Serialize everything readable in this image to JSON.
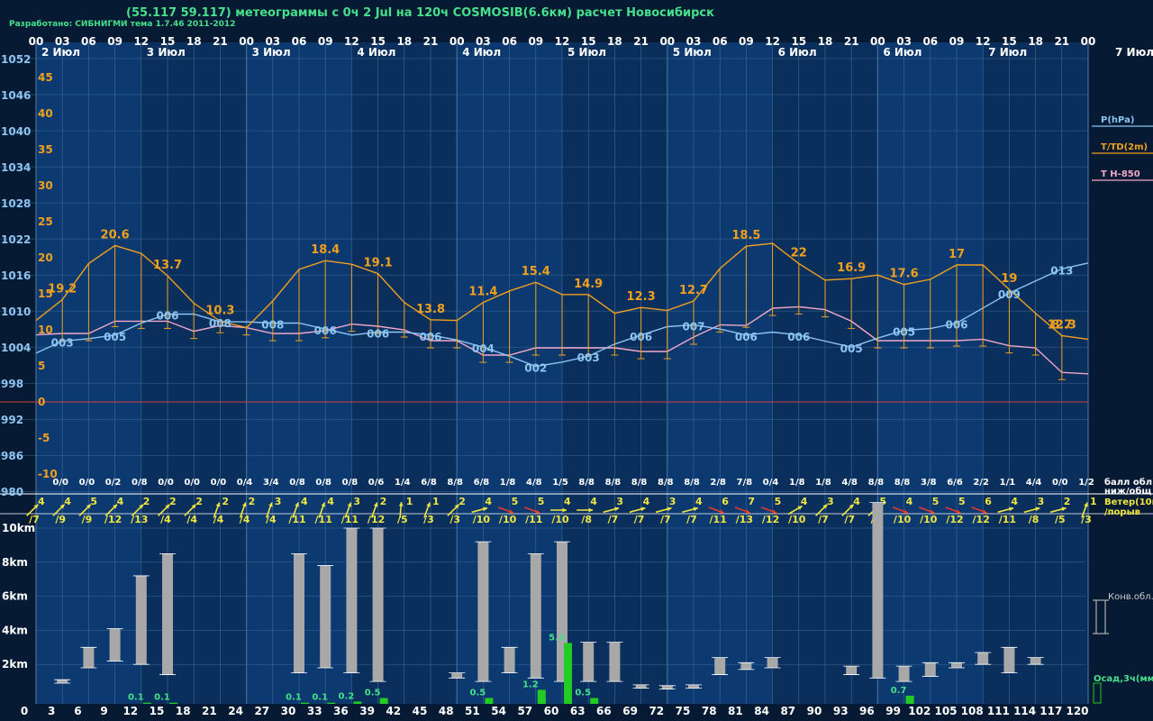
{
  "header": {
    "title": "(55.117 59.117) метеограммы с  0ч 2 Jul на 120ч COSMOSIB(6.6км) расчет Новосибирск",
    "credit": "Разработано: СИБНИГМИ тема 1.7.46 2011-2012"
  },
  "colors": {
    "bg_dark": "#061a33",
    "bg_day": "#0c3a70",
    "grid": "#3f6a96",
    "pressure": "#8cc4f2",
    "temp": "#f0a01e",
    "t850": "#f2a8c8",
    "zero_line": "#c84040",
    "wind_normal": "#f0e640",
    "wind_strong": "#e83a28",
    "cloud_bar": "#a8a8a8",
    "precip": "#22cc22",
    "precip_text": "#46e08a",
    "label": "#ffffff",
    "legend_text": "#f0e640"
  },
  "chart_data": {
    "type": "line",
    "hours": [
      0,
      3,
      6,
      9,
      12,
      15,
      18,
      21,
      24,
      27,
      30,
      33,
      36,
      39,
      42,
      45,
      48,
      51,
      54,
      57,
      60,
      63,
      66,
      69,
      72,
      75,
      78,
      81,
      84,
      87,
      90,
      93,
      96,
      99,
      102,
      105,
      108,
      111,
      114,
      117,
      120
    ],
    "utc_hours": [
      "00",
      "03",
      "06",
      "09",
      "12",
      "15",
      "18",
      "21",
      "00",
      "03",
      "06",
      "09",
      "12",
      "15",
      "18",
      "21",
      "00",
      "03",
      "06",
      "09",
      "12",
      "15",
      "18",
      "21",
      "00",
      "03",
      "06",
      "09",
      "12",
      "15",
      "18",
      "21",
      "00",
      "03",
      "06",
      "09",
      "12",
      "15",
      "18",
      "21",
      "00"
    ],
    "day_labels": [
      "2 Июл",
      "3 Июл",
      "3 Июл",
      "4 Июл",
      "4 Июл",
      "5 Июл",
      "5 Июл",
      "6 Июл",
      "6 Июл",
      "7 Июл"
    ],
    "corner_day_label": "7 Июл",
    "bottom_hour_ticks": [
      "3",
      "6",
      "9",
      "12",
      "15",
      "18",
      "21",
      "24",
      "27",
      "30",
      "33",
      "36",
      "39",
      "42",
      "45",
      "48",
      "51",
      "54",
      "57",
      "60",
      "63",
      "66",
      "69",
      "72",
      "75",
      "78",
      "81",
      "84",
      "87",
      "90",
      "93",
      "96",
      "99",
      "102",
      "105",
      "108",
      "111",
      "114",
      "117",
      "120"
    ],
    "bottom_axis_start": "0",
    "pressure_axis": {
      "labels": [
        "1052",
        "1046",
        "1040",
        "1034",
        "1028",
        "1022",
        "1016",
        "1010",
        "1004",
        "998",
        "992",
        "986",
        "980"
      ],
      "min": 980,
      "max": 1054
    },
    "temp_axis": {
      "labels": [
        "45",
        "40",
        "35",
        "30",
        "25",
        "20",
        "15",
        "10",
        "5",
        "0",
        "-5",
        "-10"
      ],
      "min": -15,
      "max": 49
    },
    "series": [
      {
        "name": "P(hPa)",
        "key": "pressure",
        "values": [
          1003,
          1005,
          1005.4,
          1006,
          1008,
          1009.5,
          1009.5,
          1008.2,
          1008.2,
          1008,
          1008,
          1007,
          1006,
          1006.5,
          1006.5,
          1006,
          1005.2,
          1004,
          1002.5,
          1000.8,
          1001.5,
          1002.5,
          1004.5,
          1006,
          1007.4,
          1007.7,
          1007,
          1006,
          1006.5,
          1006,
          1005,
          1004,
          1005.5,
          1006.8,
          1007.1,
          1008,
          1010.5,
          1013,
          1015,
          1017,
          1018
        ]
      },
      {
        "name": "T/TD(2m)",
        "key": "temp",
        "values": [
          11.3,
          14.2,
          19.2,
          21.7,
          20.6,
          17.5,
          13.7,
          11.2,
          10.3,
          14,
          18.4,
          19.6,
          19.1,
          17.8,
          13.8,
          11.4,
          11.3,
          13.8,
          15.4,
          16.6,
          14.9,
          14.9,
          12.3,
          13.1,
          12.7,
          14,
          18.5,
          21.6,
          22,
          19.2,
          16.9,
          17.1,
          17.6,
          16.3,
          17,
          19,
          19,
          15.6,
          12.3,
          9.2,
          8.7
        ]
      },
      {
        "name": "T H-850",
        "key": "t850",
        "values": [
          9.3,
          9.5,
          9.5,
          11.2,
          11.2,
          11.2,
          9.8,
          10.6,
          10.3,
          9.5,
          9.5,
          9.9,
          10.8,
          10.5,
          10,
          8.5,
          8.5,
          6.5,
          6.5,
          7.5,
          7.5,
          7.5,
          7.5,
          7,
          7,
          9,
          10.7,
          10.6,
          13,
          13.2,
          12.8,
          11.2,
          8.5,
          8.5,
          8.5,
          8.5,
          8.7,
          7.8,
          7.5,
          4.1,
          3.9
        ]
      }
    ],
    "temp_labels": [
      {
        "h": 6,
        "text": "19.2"
      },
      {
        "h": 12,
        "text": "20.6"
      },
      {
        "h": 18,
        "text": "13.7"
      },
      {
        "h": 24,
        "text": "10.3"
      },
      {
        "h": 36,
        "text": "18.4"
      },
      {
        "h": 42,
        "text": "19.1"
      },
      {
        "h": 48,
        "text": "13.8"
      },
      {
        "h": 54,
        "text": "11.4"
      },
      {
        "h": 60,
        "text": "15.4"
      },
      {
        "h": 66,
        "text": "14.9"
      },
      {
        "h": 72,
        "text": "12.3"
      },
      {
        "h": 78,
        "text": "12.7"
      },
      {
        "h": 84,
        "text": "18.5"
      },
      {
        "h": 90,
        "text": "22"
      },
      {
        "h": 96,
        "text": "16.9"
      },
      {
        "h": 102,
        "text": "17.6"
      },
      {
        "h": 108,
        "text": "17"
      },
      {
        "h": 114,
        "text": "19"
      },
      {
        "h": 120,
        "text": "12.3"
      },
      {
        "h": 126,
        "text": "8.7"
      }
    ],
    "cloud_codes": [
      {
        "h": 3,
        "text": "003"
      },
      {
        "h": 9,
        "text": "005"
      },
      {
        "h": 15,
        "text": "006"
      },
      {
        "h": 21,
        "text": "008"
      },
      {
        "h": 27,
        "text": "008"
      },
      {
        "h": 33,
        "text": "006"
      },
      {
        "h": 39,
        "text": "006"
      },
      {
        "h": 45,
        "text": "006"
      },
      {
        "h": 51,
        "text": "004"
      },
      {
        "h": 57,
        "text": "002"
      },
      {
        "h": 63,
        "text": "003"
      },
      {
        "h": 69,
        "text": "006"
      },
      {
        "h": 75,
        "text": "007"
      },
      {
        "h": 81,
        "text": "006"
      },
      {
        "h": 87,
        "text": "006"
      },
      {
        "h": 93,
        "text": "005"
      },
      {
        "h": 99,
        "text": "005"
      },
      {
        "h": 105,
        "text": "006"
      },
      {
        "h": 111,
        "text": "009"
      },
      {
        "h": 117,
        "text": "013"
      }
    ],
    "cloud_cover": [
      "0/0",
      "0/0",
      "0/2",
      "0/8",
      "0/0",
      "0/0",
      "0/0",
      "0/4",
      "3/4",
      "0/8",
      "0/8",
      "0/8",
      "0/6",
      "1/4",
      "6/8",
      "8/8",
      "6/8",
      "1/8",
      "4/8",
      "1/5",
      "8/8",
      "8/8",
      "8/8",
      "8/8",
      "8/8",
      "2/8",
      "7/8",
      "0/4",
      "1/8",
      "1/8",
      "4/8",
      "8/8",
      "8/8",
      "3/8",
      "6/6",
      "2/2",
      "1/1",
      "4/4",
      "0/0",
      "1/2"
    ],
    "cloud_legend": [
      "балл обл.",
      "ниж/общ"
    ],
    "wind": [
      {
        "speed": "4",
        "gust": "/7",
        "dir": 225,
        "strong": false
      },
      {
        "speed": "4",
        "gust": "/9",
        "dir": 225,
        "strong": false
      },
      {
        "speed": "5",
        "gust": "/9",
        "dir": 225,
        "strong": false
      },
      {
        "speed": "4",
        "gust": "/12",
        "dir": 225,
        "strong": false
      },
      {
        "speed": "2",
        "gust": "/13",
        "dir": 225,
        "strong": false
      },
      {
        "speed": "2",
        "gust": "/4",
        "dir": 225,
        "strong": false
      },
      {
        "speed": "2",
        "gust": "/4",
        "dir": 225,
        "strong": false
      },
      {
        "speed": "2",
        "gust": "/4",
        "dir": 200,
        "strong": false
      },
      {
        "speed": "2",
        "gust": "/4",
        "dir": 200,
        "strong": false
      },
      {
        "speed": "3",
        "gust": "/4",
        "dir": 200,
        "strong": false
      },
      {
        "speed": "4",
        "gust": "/11",
        "dir": 200,
        "strong": false
      },
      {
        "speed": "4",
        "gust": "/11",
        "dir": 200,
        "strong": false
      },
      {
        "speed": "3",
        "gust": "/11",
        "dir": 200,
        "strong": false
      },
      {
        "speed": "2",
        "gust": "/12",
        "dir": 200,
        "strong": false
      },
      {
        "speed": "1",
        "gust": "/5",
        "dir": 185,
        "strong": false
      },
      {
        "speed": "1",
        "gust": "/3",
        "dir": 200,
        "strong": false
      },
      {
        "speed": "2",
        "gust": "/3",
        "dir": 225,
        "strong": false
      },
      {
        "speed": "4",
        "gust": "/10",
        "dir": 255,
        "strong": false
      },
      {
        "speed": "5",
        "gust": "/10",
        "dir": 290,
        "strong": true
      },
      {
        "speed": "5",
        "gust": "/11",
        "dir": 290,
        "strong": true
      },
      {
        "speed": "4",
        "gust": "/10",
        "dir": 270,
        "strong": false
      },
      {
        "speed": "4",
        "gust": "/8",
        "dir": 270,
        "strong": false
      },
      {
        "speed": "3",
        "gust": "/7",
        "dir": 255,
        "strong": false
      },
      {
        "speed": "4",
        "gust": "/7",
        "dir": 255,
        "strong": false
      },
      {
        "speed": "3",
        "gust": "/7",
        "dir": 255,
        "strong": false
      },
      {
        "speed": "4",
        "gust": "/7",
        "dir": 255,
        "strong": false
      },
      {
        "speed": "6",
        "gust": "/11",
        "dir": 290,
        "strong": true
      },
      {
        "speed": "7",
        "gust": "/13",
        "dir": 290,
        "strong": true
      },
      {
        "speed": "5",
        "gust": "/12",
        "dir": 290,
        "strong": true
      },
      {
        "speed": "4",
        "gust": "/10",
        "dir": 240,
        "strong": false
      },
      {
        "speed": "3",
        "gust": "/7",
        "dir": 225,
        "strong": false
      },
      {
        "speed": "4",
        "gust": "/7",
        "dir": 225,
        "strong": false
      },
      {
        "speed": "5",
        "gust": "/9",
        "dir": 225,
        "strong": false
      },
      {
        "speed": "4",
        "gust": "/10",
        "dir": 290,
        "strong": true
      },
      {
        "speed": "5",
        "gust": "/10",
        "dir": 290,
        "strong": true
      },
      {
        "speed": "5",
        "gust": "/12",
        "dir": 290,
        "strong": true
      },
      {
        "speed": "6",
        "gust": "/12",
        "dir": 290,
        "strong": true
      },
      {
        "speed": "4",
        "gust": "/11",
        "dir": 255,
        "strong": false
      },
      {
        "speed": "3",
        "gust": "/8",
        "dir": 255,
        "strong": false
      },
      {
        "speed": "2",
        "gust": "/5",
        "dir": 255,
        "strong": false
      },
      {
        "speed": "1",
        "gust": "/3",
        "dir": 200,
        "strong": false
      }
    ],
    "wind_legend": [
      "Ветер(10м)",
      "/порыв"
    ],
    "height_axis": {
      "labels": [
        "10km",
        "8km",
        "6km",
        "4km",
        "2km"
      ],
      "min": 0,
      "max": 11.5
    },
    "convective_clouds": [
      {
        "h": 3,
        "bottom": 0.9,
        "top": 1.1
      },
      {
        "h": 6,
        "bottom": 1.8,
        "top": 3.0
      },
      {
        "h": 9,
        "bottom": 2.2,
        "top": 4.1
      },
      {
        "h": 12,
        "bottom": 2.0,
        "top": 7.2
      },
      {
        "h": 15,
        "bottom": 1.4,
        "top": 8.5
      },
      {
        "h": 30,
        "bottom": 1.5,
        "top": 8.5
      },
      {
        "h": 33,
        "bottom": 1.8,
        "top": 7.8
      },
      {
        "h": 36,
        "bottom": 1.5,
        "top": 10.0
      },
      {
        "h": 39,
        "bottom": 1.0,
        "top": 10.0
      },
      {
        "h": 48,
        "bottom": 1.2,
        "top": 1.5
      },
      {
        "h": 51,
        "bottom": 1.0,
        "top": 9.2
      },
      {
        "h": 54,
        "bottom": 1.5,
        "top": 3.0
      },
      {
        "h": 57,
        "bottom": 1.2,
        "top": 8.5
      },
      {
        "h": 60,
        "bottom": 1.0,
        "top": 9.2
      },
      {
        "h": 63,
        "bottom": 1.0,
        "top": 3.3
      },
      {
        "h": 66,
        "bottom": 1.0,
        "top": 3.3
      },
      {
        "h": 69,
        "bottom": 0.6,
        "top": 0.8
      },
      {
        "h": 72,
        "bottom": 0.55,
        "top": 0.75
      },
      {
        "h": 75,
        "bottom": 0.6,
        "top": 0.8
      },
      {
        "h": 78,
        "bottom": 1.4,
        "top": 2.4
      },
      {
        "h": 81,
        "bottom": 1.7,
        "top": 2.1
      },
      {
        "h": 84,
        "bottom": 1.8,
        "top": 2.4
      },
      {
        "h": 93,
        "bottom": 1.4,
        "top": 1.9
      },
      {
        "h": 96,
        "bottom": 1.2,
        "top": 11.5
      },
      {
        "h": 99,
        "bottom": 1.0,
        "top": 1.9
      },
      {
        "h": 102,
        "bottom": 1.3,
        "top": 2.1
      },
      {
        "h": 105,
        "bottom": 1.8,
        "top": 2.1
      },
      {
        "h": 108,
        "bottom": 2.0,
        "top": 2.7
      },
      {
        "h": 111,
        "bottom": 1.5,
        "top": 3.0
      },
      {
        "h": 114,
        "bottom": 2.0,
        "top": 2.4
      }
    ],
    "precipitation": [
      {
        "h": 12,
        "value": 0.1,
        "label": "0.1"
      },
      {
        "h": 15,
        "value": 0.1,
        "label": "0.1"
      },
      {
        "h": 30,
        "value": 0.1,
        "label": "0.1"
      },
      {
        "h": 33,
        "value": 0.1,
        "label": "0.1"
      },
      {
        "h": 36,
        "value": 0.2,
        "label": "0.2"
      },
      {
        "h": 39,
        "value": 0.5,
        "label": "0.5"
      },
      {
        "h": 51,
        "value": 0.5,
        "label": "0.5"
      },
      {
        "h": 57,
        "value": 1.2,
        "label": "1.2"
      },
      {
        "h": 60,
        "value": 5.2,
        "label": "5.2"
      },
      {
        "h": 63,
        "value": 0.5,
        "label": "0.5"
      },
      {
        "h": 99,
        "value": 0.7,
        "label": "0.7"
      }
    ],
    "legend": {
      "pressure": "P(hPa)",
      "temp": "T/TD(2m)",
      "t850": "T H-850",
      "conv": "Конв.обл.",
      "precip": "Осад,3ч(мм)"
    }
  }
}
